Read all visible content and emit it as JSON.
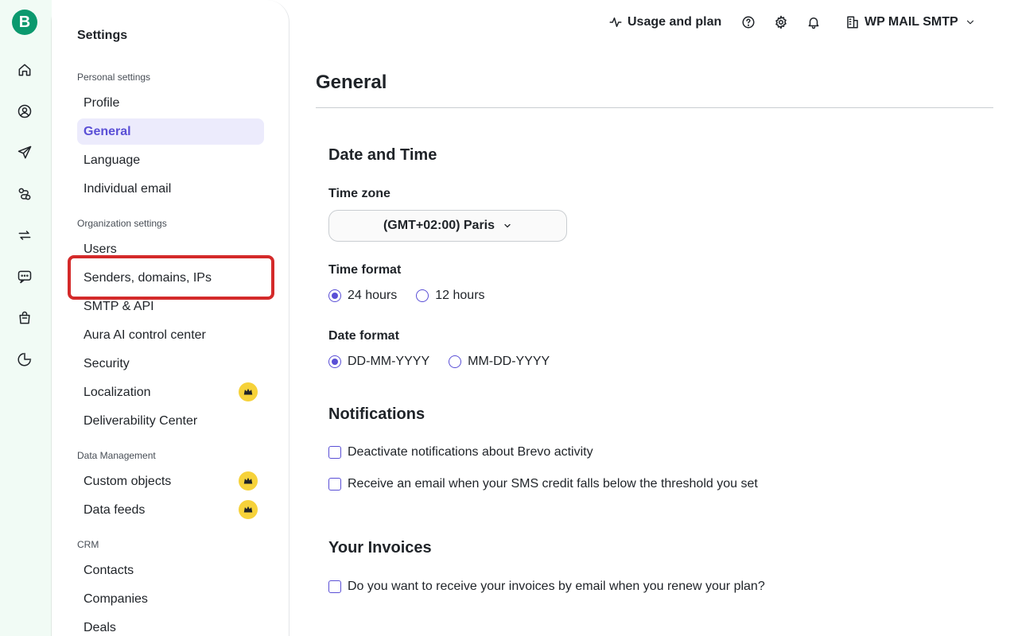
{
  "rail": {
    "logo_letter": "B",
    "icons": [
      "home-icon",
      "contacts-icon",
      "campaigns-icon",
      "automations-icon",
      "conversations-icon",
      "chat-icon",
      "shop-icon",
      "reports-icon"
    ]
  },
  "topbar": {
    "usage_label": "Usage and plan",
    "account_name": "WP MAIL SMTP"
  },
  "sidebar": {
    "title": "Settings",
    "sections": [
      {
        "label": "Personal settings",
        "items": [
          {
            "label": "Profile"
          },
          {
            "label": "General",
            "active": true
          },
          {
            "label": "Language"
          },
          {
            "label": "Individual email"
          }
        ]
      },
      {
        "label": "Organization settings",
        "items": [
          {
            "label": "Users"
          },
          {
            "label": "Senders, domains, IPs"
          },
          {
            "label": "SMTP & API"
          },
          {
            "label": "Aura AI control center"
          },
          {
            "label": "Security"
          },
          {
            "label": "Localization",
            "premium": true
          },
          {
            "label": "Deliverability Center"
          }
        ]
      },
      {
        "label": "Data Management",
        "items": [
          {
            "label": "Custom objects",
            "premium": true
          },
          {
            "label": "Data feeds",
            "premium": true
          }
        ]
      },
      {
        "label": "CRM",
        "items": [
          {
            "label": "Contacts"
          },
          {
            "label": "Companies"
          },
          {
            "label": "Deals"
          }
        ]
      }
    ]
  },
  "main": {
    "title": "General",
    "date_time": {
      "heading": "Date and Time",
      "timezone_label": "Time zone",
      "timezone_value": "(GMT+02:00) Paris",
      "time_format_label": "Time format",
      "time_format_options": [
        "24 hours",
        "12 hours"
      ],
      "time_format_selected": "24 hours",
      "date_format_label": "Date format",
      "date_format_options": [
        "DD-MM-YYYY",
        "MM-DD-YYYY"
      ],
      "date_format_selected": "DD-MM-YYYY"
    },
    "notifications": {
      "heading": "Notifications",
      "options": [
        "Deactivate notifications about Brevo activity",
        "Receive an email when your SMS credit falls below the threshold you set"
      ]
    },
    "invoices": {
      "heading": "Your Invoices",
      "option": "Do you want to receive your invoices by email when you renew your plan?"
    }
  },
  "colors": {
    "brand_green": "#0b996e",
    "accent_purple": "#5a4fd6",
    "active_bg": "#ecebfc",
    "premium_yellow": "#f6d23a",
    "highlight_red": "#d42a2a"
  }
}
